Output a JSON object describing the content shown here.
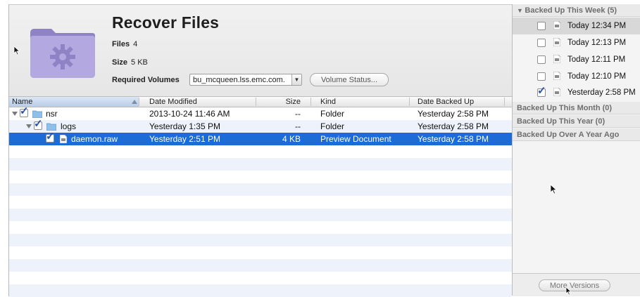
{
  "header": {
    "title": "Recover Files",
    "files_label": "Files",
    "files_value": "4",
    "size_label": "Size",
    "size_value": "5 KB",
    "volumes_label": "Required Volumes",
    "volumes_value": "bu_mcqueen.lss.emc.com.",
    "volume_status_button": "Volume Status..."
  },
  "table": {
    "columns": [
      "Name",
      "Date Modified",
      "Size",
      "Kind",
      "Date Backed Up"
    ],
    "rows": [
      {
        "name": "nsr",
        "date_modified": "2013-10-24 11:46 AM",
        "size": "--",
        "kind": "Folder",
        "date_backed_up": "Yesterday 2:58 PM",
        "checked": true,
        "icon": "folder-icon"
      },
      {
        "name": "logs",
        "date_modified": "Yesterday 1:35 PM",
        "size": "--",
        "kind": "Folder",
        "date_backed_up": "Yesterday 2:58 PM",
        "checked": true,
        "icon": "folder-icon"
      },
      {
        "name": "daemon.raw",
        "date_modified": "Yesterday 2:51 PM",
        "size": "4 KB",
        "kind": "Preview Document",
        "date_backed_up": "Yesterday 2:58 PM",
        "checked": true,
        "icon": "document-icon",
        "selected": true
      }
    ]
  },
  "versions": {
    "week_header": "Backed Up This Week (5)",
    "items": [
      {
        "label": "Today 12:34 PM",
        "checked": false
      },
      {
        "label": "Today 12:13 PM",
        "checked": false
      },
      {
        "label": "Today 12:11 PM",
        "checked": false
      },
      {
        "label": "Today 12:10 PM",
        "checked": false
      },
      {
        "label": "Yesterday 2:58 PM",
        "checked": true
      }
    ],
    "month_header": "Backed Up This Month (0)",
    "year_header": "Backed Up This Year (0)",
    "older_header": "Backed Up Over A Year Ago",
    "more_button": "More Versions"
  },
  "colors": {
    "selection": "#1c6bd6",
    "folder_purple": "#9b8fd0",
    "checkmark": "#2a53a8"
  }
}
